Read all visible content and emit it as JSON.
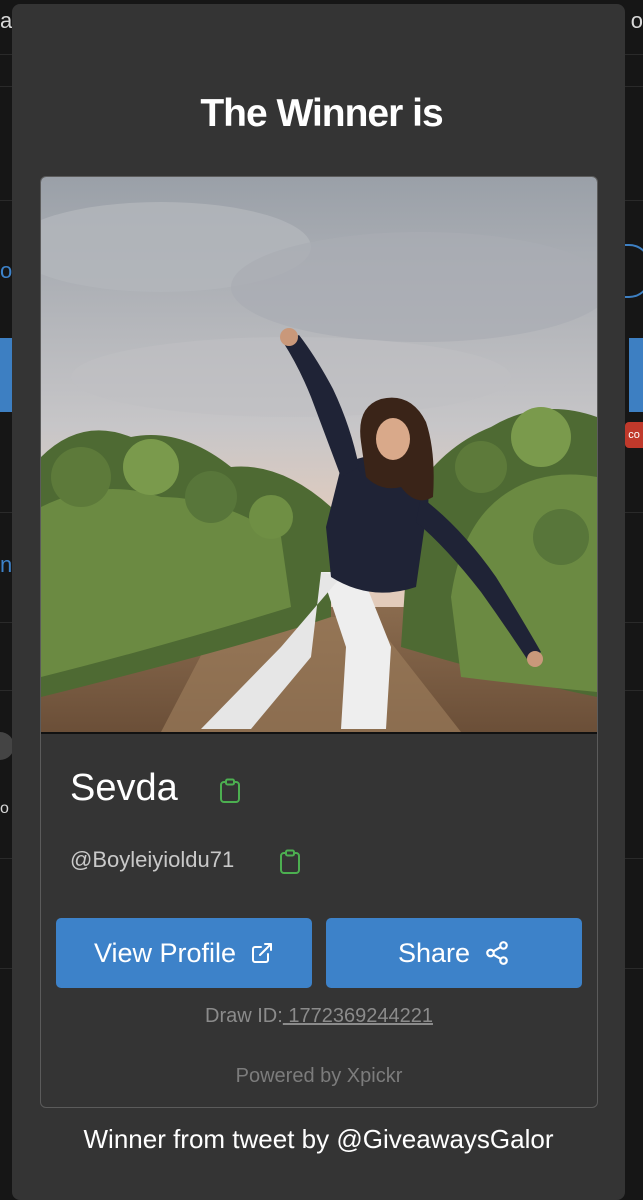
{
  "modal": {
    "title": "The Winner is",
    "winner": {
      "name": "Sevda",
      "handle": "@Boyleiyioldu71",
      "photo": "photo-of-winner"
    },
    "buttons": {
      "view_profile": "View Profile",
      "share": "Share"
    },
    "draw_id_label": "Draw ID:",
    "draw_id_value": " 1772369244221",
    "powered_by": "Powered by Xpickr",
    "footer": "Winner from tweet by @GiveawaysGalor"
  },
  "colors": {
    "modal_bg": "#343434",
    "button_blue": "#3d82c9",
    "copy_icon_green": "#4caf50",
    "muted_text": "#8b8b8b"
  },
  "icons": {
    "name_copy": "clipboard-icon",
    "handle_copy": "clipboard-icon",
    "view_profile": "external-link-icon",
    "share": "share-icon"
  },
  "background": {
    "fragments": [
      "a",
      "o",
      "o",
      "n",
      "o",
      "co"
    ]
  }
}
